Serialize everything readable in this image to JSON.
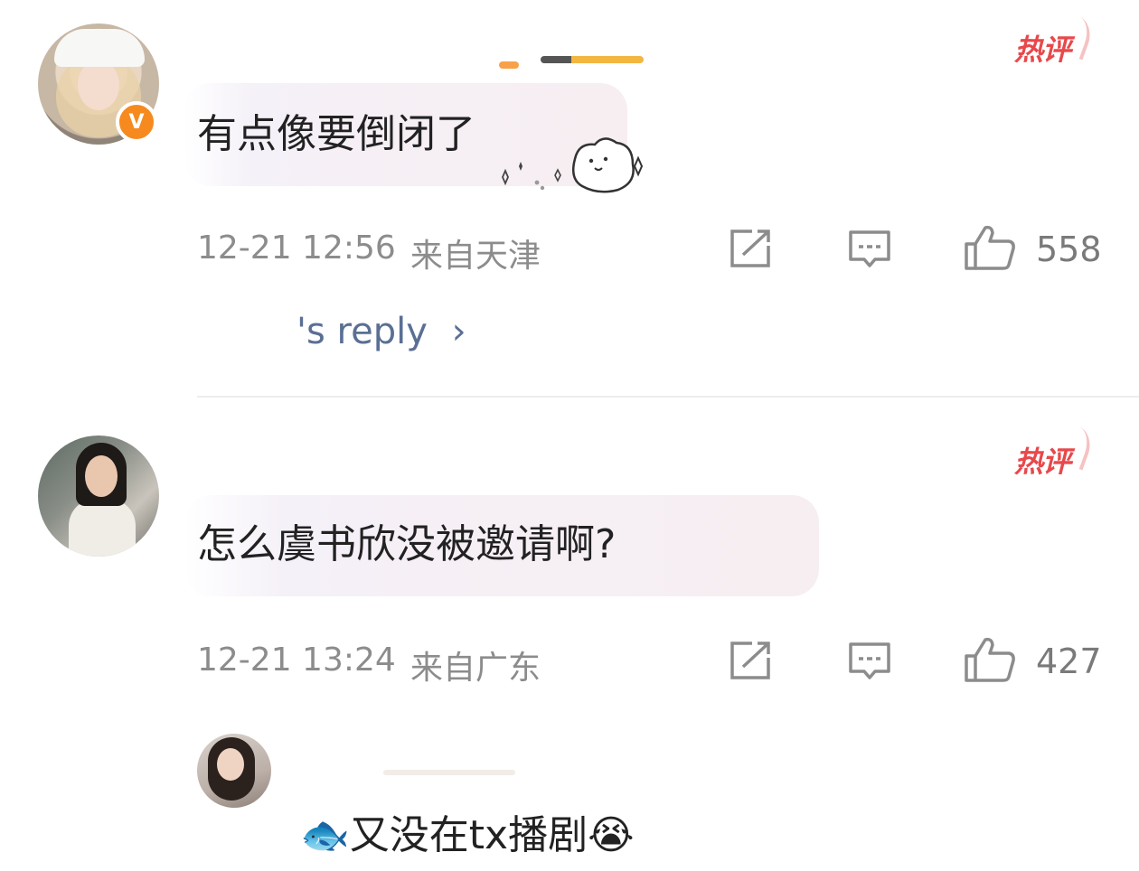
{
  "comments": [
    {
      "hot_label": "热评",
      "text": "有点像要倒闭了",
      "verified_badge": "V",
      "time": "12-21 12:56",
      "location": "来自天津",
      "likes": "558",
      "reply_link": "'s reply",
      "reply_chevron": "›"
    },
    {
      "hot_label": "热评",
      "text": "怎么虞书欣没被邀请啊?",
      "time": "12-21 13:24",
      "location": "来自广东",
      "likes": "427"
    }
  ],
  "sub_reply": {
    "text": "🐟又没在tx播剧😭"
  },
  "icons": {
    "share": "share-icon",
    "comment": "comment-icon",
    "like": "thumbs-up-icon"
  },
  "colors": {
    "hot": "#e8484b",
    "link": "#5a6f93",
    "meta": "#8c8c8c",
    "badge": "#f68a1e"
  }
}
